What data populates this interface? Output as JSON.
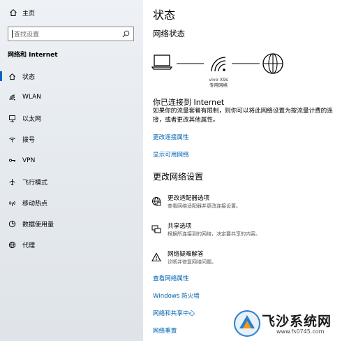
{
  "sidebar": {
    "home_label": "主页",
    "search_placeholder": "查找设置",
    "section_title": "网络和 Internet",
    "items": [
      {
        "label": "状态",
        "icon": "home-status-icon",
        "active": true
      },
      {
        "label": "WLAN",
        "icon": "wifi-icon"
      },
      {
        "label": "以太网",
        "icon": "ethernet-icon"
      },
      {
        "label": "拨号",
        "icon": "dialup-icon"
      },
      {
        "label": "VPN",
        "icon": "vpn-icon"
      },
      {
        "label": "飞行模式",
        "icon": "airplane-icon"
      },
      {
        "label": "移动热点",
        "icon": "hotspot-icon"
      },
      {
        "label": "数据使用量",
        "icon": "data-usage-icon"
      },
      {
        "label": "代理",
        "icon": "proxy-globe-icon"
      }
    ]
  },
  "main": {
    "title": "状态",
    "network_status_heading": "网络状态",
    "device_name": "vivo X9s",
    "device_type": "专用网络",
    "connected_text": "你已连接到 Internet",
    "description": "如果你的流量套餐有限制，则你可以将此网络设置为按流量计费的连接，或者更改其他属性。",
    "links1": [
      "更改连接属性",
      "显示可用网络"
    ],
    "change_heading": "更改网络设置",
    "options": [
      {
        "title": "更改适配器选项",
        "desc": "查看网络适配器并更改连接设置。",
        "icon": "adapter-icon"
      },
      {
        "title": "共享选项",
        "desc": "根据所连接到的网络，决定要共享的内容。",
        "icon": "sharing-icon"
      },
      {
        "title": "网络疑难解答",
        "desc": "诊断并修复网络问题。",
        "icon": "warning-icon"
      }
    ],
    "links2": [
      "查看网络属性",
      "Windows 防火墙",
      "网络和共享中心",
      "网络重置"
    ]
  },
  "watermark": {
    "title": "飞沙系统网",
    "url": "www.fs0745.com"
  },
  "colors": {
    "accent": "#0067c0",
    "link": "#0063b1",
    "sidebar_bg": "#e7ecf1"
  }
}
